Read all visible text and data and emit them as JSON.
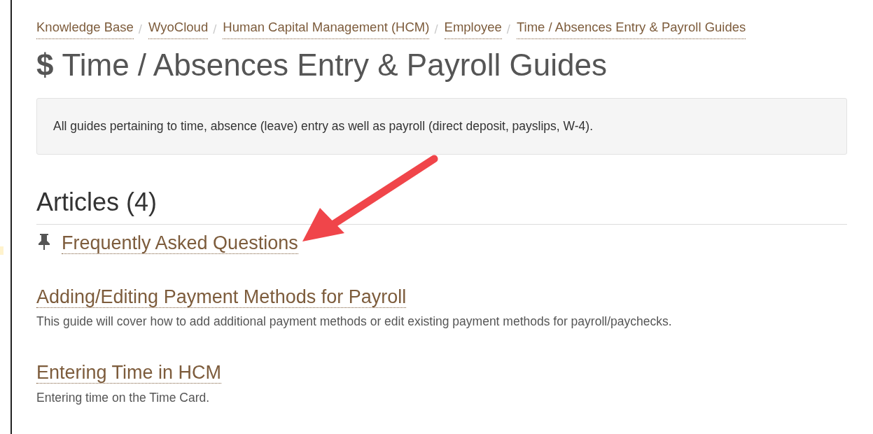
{
  "breadcrumb": [
    {
      "label": "Knowledge Base"
    },
    {
      "label": "WyoCloud"
    },
    {
      "label": "Human Capital Management (HCM)"
    },
    {
      "label": "Employee"
    },
    {
      "label": "Time / Absences Entry & Payroll Guides"
    }
  ],
  "breadcrumb_separator": "/",
  "title_symbol": "$",
  "title": "Time / Absences Entry & Payroll Guides",
  "description": "All guides pertaining to time, absence (leave) entry as well as payroll (direct deposit, payslips, W-4).",
  "articles_heading": "Articles (4)",
  "articles": [
    {
      "title": "Frequently Asked Questions",
      "pinned": true
    },
    {
      "title": "Adding/Editing Payment Methods for Payroll",
      "pinned": false,
      "summary": "This guide will cover how to add additional payment methods or edit existing payment methods for payroll/paychecks."
    },
    {
      "title": "Entering Time in HCM",
      "pinned": false,
      "summary": "Entering time on the Time Card."
    }
  ]
}
